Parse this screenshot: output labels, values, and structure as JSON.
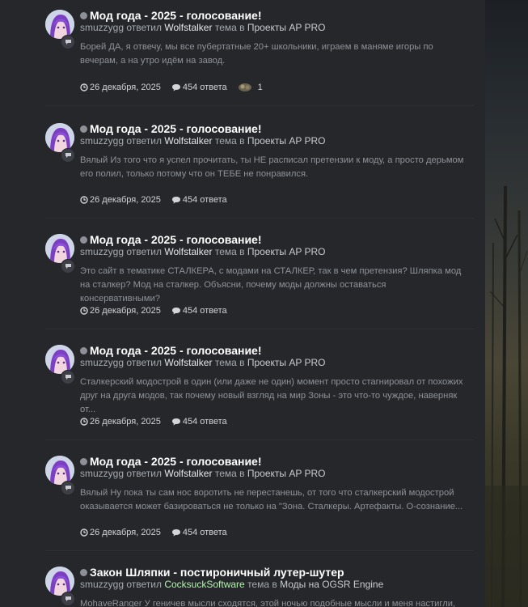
{
  "items": [
    {
      "title": "Мод года - 2025 - голосование!",
      "user": "smuzzygg",
      "action": "ответил",
      "author": "Wolfstalker",
      "topic_word": "тема в",
      "forum": "Проекты AP PRO",
      "excerpt": "Борей ДА, я отвечу, мы все пубертатные 20+ школьники, играем в маняме игоры по вечерам, а на утро идём на завод.",
      "date": "26 декабря, 2025",
      "replies": "454 ответа",
      "reactions": "1"
    },
    {
      "title": "Мод года - 2025 - голосование!",
      "user": "smuzzygg",
      "action": "ответил",
      "author": "Wolfstalker",
      "topic_word": "тема в",
      "forum": "Проекты AP PRO",
      "excerpt": "Вялый Из того что я успел прочитать, ты НЕ расписал претензии к моду, а просто дерьмом его полил, только потому что он ТЕБЕ не понравился.",
      "date": "26 декабря, 2025",
      "replies": "454 ответа"
    },
    {
      "title": "Мод года - 2025 - голосование!",
      "user": "smuzzygg",
      "action": "ответил",
      "author": "Wolfstalker",
      "topic_word": "тема в",
      "forum": "Проекты AP PRO",
      "excerpt": "Это сайт в тематике СТАЛКЕРА, с модами на СТАЛКЕР, так в чем претензия? Шляпка мод на сталкер? Мод на сталкер. Объясни, почему моды должны оставаться консервативными?",
      "date": "26 декабря, 2025",
      "replies": "454 ответа"
    },
    {
      "title": "Мод года - 2025 - голосование!",
      "user": "smuzzygg",
      "action": "ответил",
      "author": "Wolfstalker",
      "topic_word": "тема в",
      "forum": "Проекты AP PRO",
      "excerpt": "Сталкерский модострой в один (или даже не один) момент просто стагнировал от похожих друг на друга модов, так почему новый взгляд на мир Зоны - это что-то чуждое, наверняк от...",
      "date": "26 декабря, 2025",
      "replies": "454 ответа"
    },
    {
      "title": "Мод года - 2025 - голосование!",
      "user": "smuzzygg",
      "action": "ответил",
      "author": "Wolfstalker",
      "topic_word": "тема в",
      "forum": "Проекты AP PRO",
      "excerpt": "Вялый Ну пока ты сам нос воротить не перестанешь, от того что сталкерский модострой оказывается может базироваться не только на \"Зона. Сталкеры. Артефакты. О-сознание...",
      "date": "26 декабря, 2025",
      "replies": "454 ответа"
    },
    {
      "title": "Закон Шляпки - постироничный лутер-шутер",
      "user": "smuzzygg",
      "action": "ответил",
      "author": "CocksuckSoftware",
      "topic_word": "тема в",
      "forum": "Моды на OGSR Engine",
      "excerpt": "MohaveRanger У геничев мысли сходятся, этой ночью подобные мысли и меня настигли, хоть и"
    }
  ],
  "colors": {
    "background": "#25272b",
    "title": "#ffffff",
    "meta": "#a5a9ae",
    "excerpt": "#8e9298",
    "author_green": "#b6f3b0"
  },
  "icons": {
    "date": "clock-icon",
    "replies": "comment-icon",
    "avatar_badge": "comment-icon"
  }
}
